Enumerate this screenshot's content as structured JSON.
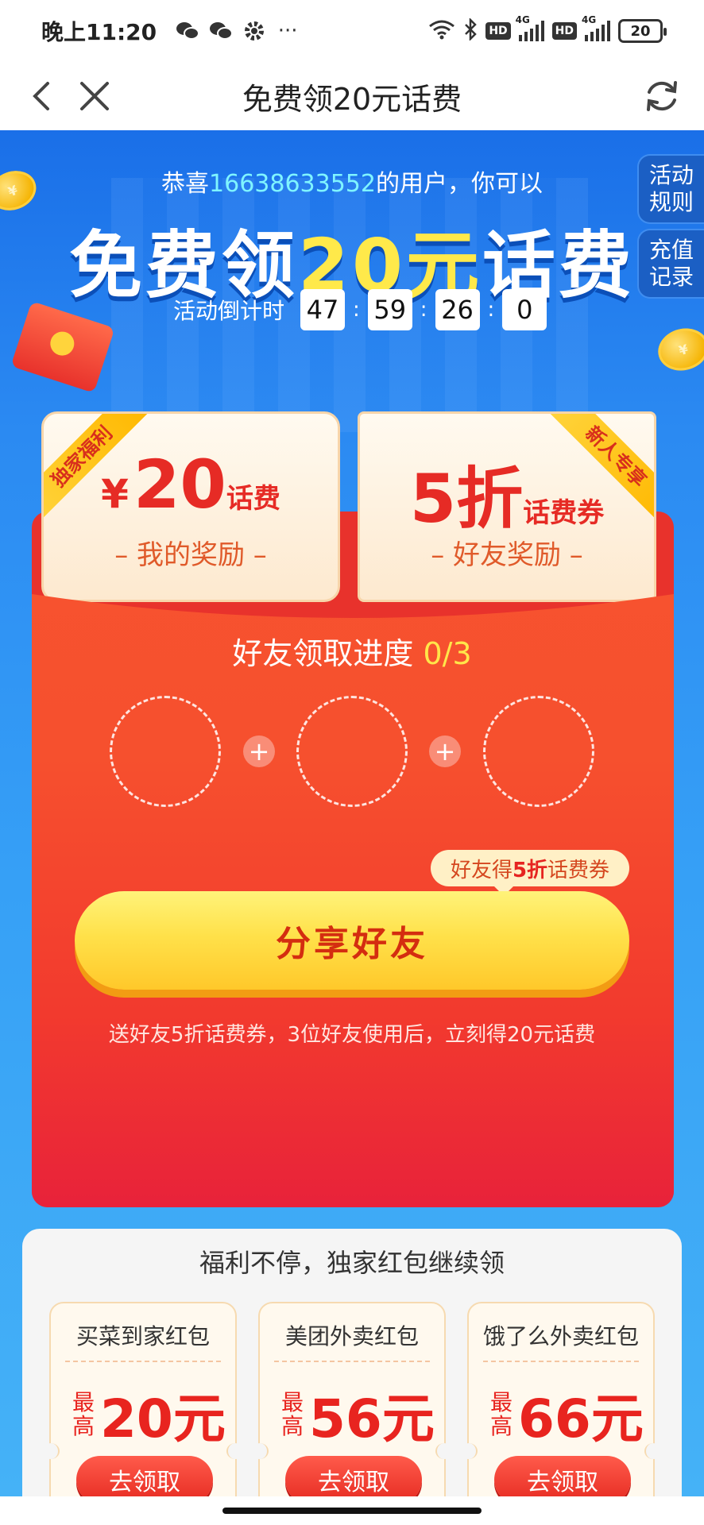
{
  "status_bar": {
    "time": "晚上11:20",
    "icons": [
      "wechat-icon",
      "wechat-icon",
      "gear-icon",
      "more-icon"
    ],
    "more": "···",
    "hd": "HD",
    "net": "4G",
    "battery": "20"
  },
  "nav": {
    "title": "免费领20元话费"
  },
  "hero": {
    "congrats_prefix": "恭喜",
    "phone": "16638633552",
    "congrats_suffix": "的用户，你可以",
    "headline_a": "免费领",
    "headline_highlight": "20元",
    "headline_b": "话费",
    "countdown_label": "活动倒计时",
    "countdown": [
      "47",
      "59",
      "26",
      "0"
    ],
    "countdown_sep": ":"
  },
  "side": {
    "rules": "活动规则",
    "records": "充值记录"
  },
  "cards": {
    "mine": {
      "ribbon": "独家福利",
      "yen": "¥",
      "value": "20",
      "unit": "话费",
      "sub": "– 我的奖励 –"
    },
    "friend": {
      "ribbon": "新人专享",
      "value": "5折",
      "unit": "话费券",
      "sub": "– 好友奖励 –"
    }
  },
  "progress": {
    "title": "好友领取进度 ",
    "count": "0/3",
    "plus": "+"
  },
  "tooltip": {
    "prefix": "好友得",
    "highlight": "5折",
    "suffix": "话费券"
  },
  "share": {
    "button": "分享好友",
    "desc": "送好友5折话费券，3位好友使用后，立刻得20元话费"
  },
  "welfare": {
    "title": "福利不停，独家红包继续领",
    "prefix": "最高",
    "items": [
      {
        "name": "买菜到家红包",
        "value": "20元",
        "button": "去领取"
      },
      {
        "name": "美团外卖红包",
        "value": "56元",
        "button": "去领取"
      },
      {
        "name": "饿了么外卖红包",
        "value": "66元",
        "button": "去领取"
      }
    ]
  },
  "colors": {
    "primary_blue": "#2b8af2",
    "envelope_red": "#f23a2e",
    "highlight_yellow": "#ffe94a",
    "price_red": "#e8241f"
  }
}
